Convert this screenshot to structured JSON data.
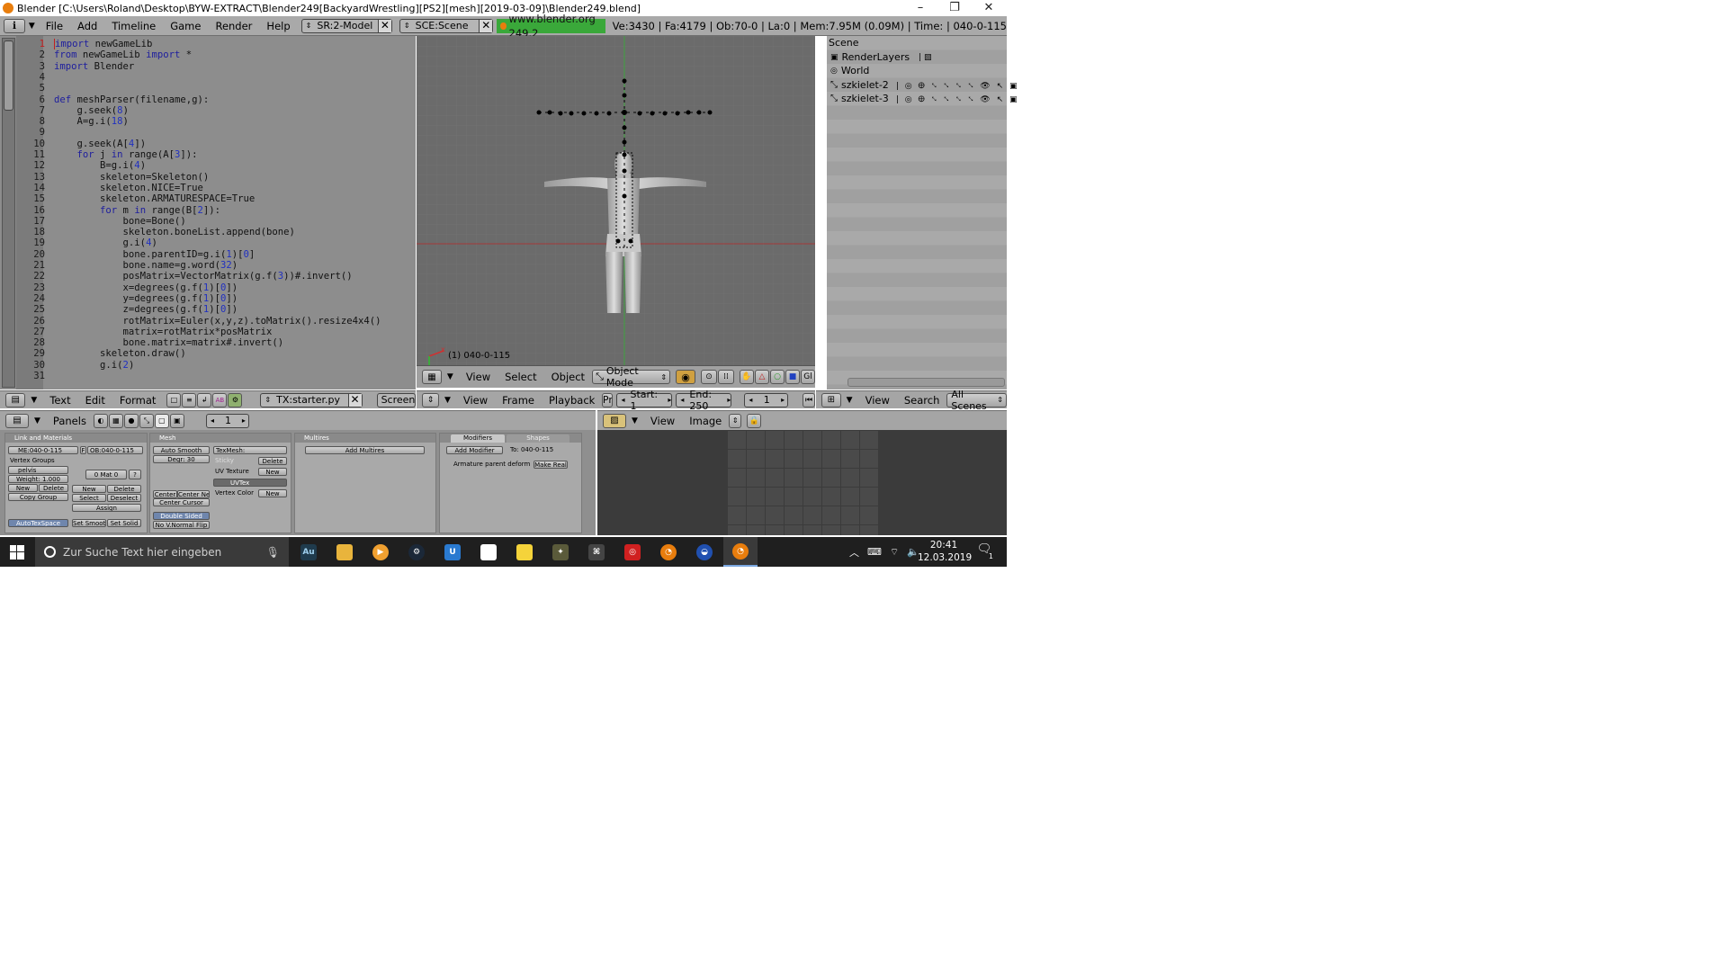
{
  "window": {
    "title": "Blender [C:\\Users\\Roland\\Desktop\\BYW-EXTRACT\\Blender249[BackyardWrestling][PS2][mesh][2019-03-09]\\Blender249.blend]",
    "minimize": "–",
    "maximize": "❐",
    "close": "✕"
  },
  "topbar": {
    "menus": [
      "File",
      "Add",
      "Timeline",
      "Game",
      "Render",
      "Help"
    ],
    "screen_field": "SR:2-Model",
    "scene_field": "SCE:Scene",
    "link": "www.blender.org 249.2",
    "stats": "Ve:3430 | Fa:4179 | Ob:70-0 | La:0 | Mem:7.95M (0.09M) | Time: | 040-0-115"
  },
  "text_editor": {
    "line_numbers": [
      "1",
      "2",
      "3",
      "4",
      "5",
      "6",
      "7",
      "8",
      "9",
      "10",
      "11",
      "12",
      "13",
      "14",
      "15",
      "16",
      "17",
      "18",
      "19",
      "20",
      "21",
      "22",
      "23",
      "24",
      "25",
      "26",
      "27",
      "28",
      "29",
      "30",
      "31"
    ],
    "lines": [
      "import newGameLib",
      "from newGameLib import *",
      "import Blender",
      "",
      "",
      "def meshParser(filename,g):",
      "    g.seek(8)",
      "    A=g.i(18)",
      "",
      "    g.seek(A[4])",
      "    for j in range(A[3]):",
      "        B=g.i(4)",
      "        skeleton=Skeleton()",
      "        skeleton.NICE=True",
      "        skeleton.ARMATURESPACE=True",
      "        for m in range(B[2]):",
      "            bone=Bone()",
      "            skeleton.boneList.append(bone)",
      "            g.i(4)",
      "            bone.parentID=g.i(1)[0]",
      "            bone.name=g.word(32)",
      "            posMatrix=VectorMatrix(g.f(3))#.invert()",
      "            x=degrees(g.f(1)[0])",
      "            y=degrees(g.f(1)[0])",
      "            z=degrees(g.f(1)[0])",
      "            rotMatrix=Euler(x,y,z).toMatrix().resize4x4()",
      "            matrix=rotMatrix*posMatrix",
      "            bone.matrix=matrix#.invert()",
      "        skeleton.draw()",
      "        g.i(2)",
      ""
    ],
    "header": {
      "menus": [
        "Text",
        "Edit",
        "Format"
      ],
      "file_field": "TX:starter.py",
      "screen_field": "Screen 15"
    }
  },
  "viewport": {
    "frame_label": "(1) 040-0-115",
    "header": {
      "menus": [
        "View",
        "Select",
        "Object"
      ],
      "mode": "Object Mode",
      "gl_label": "Gl"
    }
  },
  "timeline": {
    "menus": [
      "View",
      "Frame",
      "Playback"
    ],
    "pr_label": "Pr",
    "start": "Start: 1",
    "end": "End: 250",
    "current": "1"
  },
  "outliner": {
    "title": "Scene",
    "rows": [
      {
        "label": "RenderLayers",
        "level": 1
      },
      {
        "label": "World",
        "level": 1
      },
      {
        "label": "szkielet-2",
        "level": 1
      },
      {
        "label": "szkielet-3",
        "level": 1
      }
    ],
    "header": {
      "menus": [
        "View",
        "Search"
      ],
      "filter": "All Scenes"
    }
  },
  "buttons": {
    "header": {
      "label": "Panels",
      "frame": "1"
    },
    "link_materials": {
      "title": "Link and Materials",
      "me_field": "ME:040-0-115",
      "f_label": "F",
      "ob_field": "OB:040-0-115",
      "vertex_groups": "Vertex Groups",
      "group": "pelvis",
      "weight": "Weight: 1.000",
      "new": "New",
      "delete": "Delete",
      "copy_group": "Copy Group",
      "mat": "0 Mat 0",
      "q": "?",
      "mat_new": "New",
      "mat_delete": "Delete",
      "select": "Select",
      "deselect": "Deselect",
      "assign": "Assign",
      "autotexspace": "AutoTexSpace",
      "set_smooth": "Set Smooth",
      "set_solid": "Set Solid"
    },
    "mesh": {
      "title": "Mesh",
      "auto_smooth": "Auto Smooth",
      "degr": "Degr: 30",
      "texmesh": "TexMesh:",
      "sticky": "Sticky",
      "sticky_delete": "Delete",
      "uv_texture": "UV Texture",
      "uv_new": "New",
      "uvtex": "UVTex",
      "vertex_color": "Vertex Color",
      "vc_new": "New",
      "center": "Center",
      "center_new": "Center New",
      "center_cursor": "Center Cursor",
      "double_sided": "Double Sided",
      "no_vnormal_flip": "No V.Normal Flip"
    },
    "multires": {
      "title": "Multires",
      "add": "Add Multires"
    },
    "modifiers": {
      "tab1": "Modifiers",
      "tab2": "Shapes",
      "add_modifier": "Add Modifier",
      "to": "To: 040-0-115",
      "armature": "Armature parent deform",
      "make_real": "Make Real"
    }
  },
  "image_editor": {
    "menus": [
      "View",
      "Image"
    ]
  },
  "taskbar": {
    "search_placeholder": "Zur Suche Text hier eingeben",
    "time": "20:41",
    "date": "12.03.2019",
    "notifications": "1",
    "apps": [
      "Au",
      "folder",
      "media-player",
      "steam",
      "u",
      "notepad",
      "sticky-notes",
      "app",
      "app",
      "app",
      "blender",
      "app",
      "blender"
    ]
  },
  "colors": {
    "accent_green": "#3aa83a",
    "blender_grey": "#a9a9a9",
    "taskbar": "#1f1f1f"
  }
}
